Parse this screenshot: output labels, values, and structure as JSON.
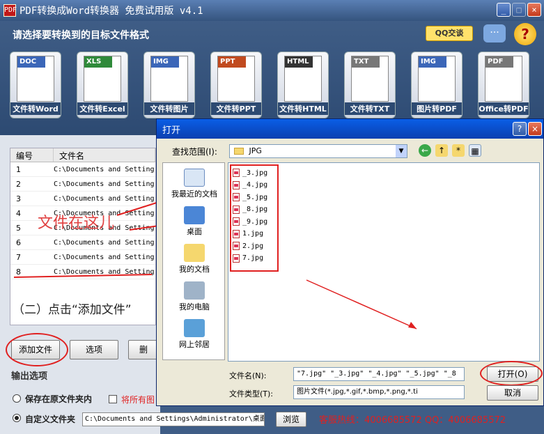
{
  "app": {
    "title": "PDF转换成Word转换器 免费试用版 v4.1",
    "icon": "PDF"
  },
  "window_controls": {
    "minimize": "_",
    "maximize": "□",
    "close": "×"
  },
  "header": {
    "prompt": "请选择要转换到的目标文件格式",
    "qq": "QQ交谈",
    "help": "?"
  },
  "formats": [
    {
      "tag": "DOC",
      "label": "文件转Word",
      "color": "#3b66b8"
    },
    {
      "tag": "XLS",
      "label": "文件转Excel",
      "color": "#2f8a3a"
    },
    {
      "tag": "IMG",
      "label": "文件转图片",
      "color": "#3b66b8"
    },
    {
      "tag": "PPT",
      "label": "文件转PPT",
      "color": "#c14a1f"
    },
    {
      "tag": "HTML",
      "label": "文件转HTML",
      "color": "#333333"
    },
    {
      "tag": "TXT",
      "label": "文件转TXT",
      "color": "#777777"
    },
    {
      "tag": "IMG",
      "label": "图片转PDF",
      "color": "#3b66b8"
    },
    {
      "tag": "PDF",
      "label": "Office转PDF",
      "color": "#777777"
    }
  ],
  "table": {
    "headers": [
      "编号",
      "文件名"
    ],
    "rows": [
      {
        "num": "1",
        "path": "C:\\Documents and Setting"
      },
      {
        "num": "2",
        "path": "C:\\Documents and Setting"
      },
      {
        "num": "3",
        "path": "C:\\Documents and Setting"
      },
      {
        "num": "4",
        "path": "C:\\Documents and Setting"
      },
      {
        "num": "5",
        "path": "C:\\Documents and Setting"
      },
      {
        "num": "6",
        "path": "C:\\Documents and Setting"
      },
      {
        "num": "7",
        "path": "C:\\Documents and Setting"
      },
      {
        "num": "8",
        "path": "C:\\Documents and Setting"
      }
    ]
  },
  "annotations": {
    "files_here": "文件在这儿",
    "step2": "（二）点击“添加文件”"
  },
  "buttons": {
    "add_file": "添加文件",
    "select": "选项",
    "delete": "删"
  },
  "output": {
    "title": "输出选项",
    "save_orig": "保存在原文件夹内",
    "all_images": "将所有图",
    "custom": "自定义文件夹",
    "path": "C:\\Documents and Settings\\Administrator\\桌面",
    "browse": "浏览"
  },
  "hotline": "客服热线：4006685572 QQ：4006685572",
  "dialog": {
    "title": "打开",
    "help": "?",
    "close": "×",
    "look_in_label": "查找范围(I):",
    "look_in_value": "JPG",
    "places": [
      "我最近的文档",
      "桌面",
      "我的文档",
      "我的电脑",
      "网上邻居"
    ],
    "files": [
      "_3.jpg",
      "_4.jpg",
      "_5.jpg",
      "_8.jpg",
      "_9.jpg",
      "1.jpg",
      "2.jpg",
      "7.jpg"
    ],
    "filename_label": "文件名(N):",
    "filename_value": "\"7.jpg\" \"_3.jpg\" \"_4.jpg\" \"_5.jpg\" \"_8",
    "filetype_label": "文件类型(T):",
    "filetype_value": "图片文件(*.jpg,*.gif,*.bmp,*.png,*.ti",
    "open_btn": "打开(O)",
    "cancel_btn": "取消"
  }
}
